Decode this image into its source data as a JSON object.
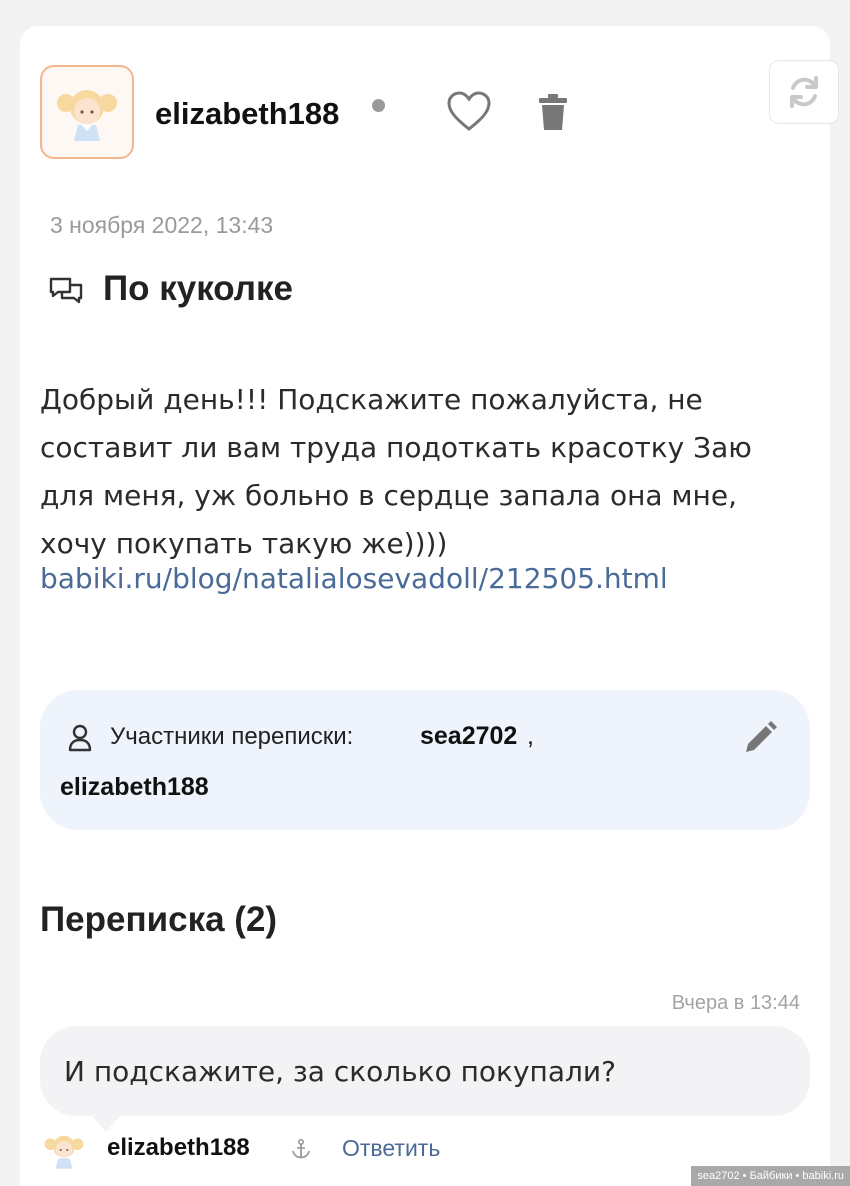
{
  "post": {
    "author": "elizabeth188",
    "date": "3 ноября 2022, 13:43",
    "title": "По куколке",
    "text": "Добрый день!!! Подскажите пожалуйста, не составит ли вам труда подоткать красотку Заю для меня, уж больно в сердце запала она мне, хочу покупать такую же))))",
    "link": "babiki.ru/blog/natalialosevadoll/212505.html"
  },
  "participants": {
    "label": "Участники переписки:",
    "first": "sea2702",
    "separator": ",",
    "second": "elizabeth188"
  },
  "correspondence": {
    "title": "Переписка (2)"
  },
  "comment": {
    "time": "Вчера в 13:44",
    "text": "И подскажите, за сколько покупали?",
    "author": "elizabeth188",
    "reply_label": "Ответить"
  },
  "watermark": "sea2702 • Байбики • babiki.ru",
  "icons": {
    "like": "heart-icon",
    "delete": "trash-icon",
    "refresh": "refresh-icon",
    "topic": "chat-bubbles-icon",
    "participants": "person-icon",
    "edit": "pencil-icon",
    "anchor": "anchor-icon"
  },
  "colors": {
    "link": "#4a6b98",
    "participants_bg": "#eef3fc",
    "bubble_bg": "#f3f3f5",
    "avatar_border": "#f2b78f"
  }
}
